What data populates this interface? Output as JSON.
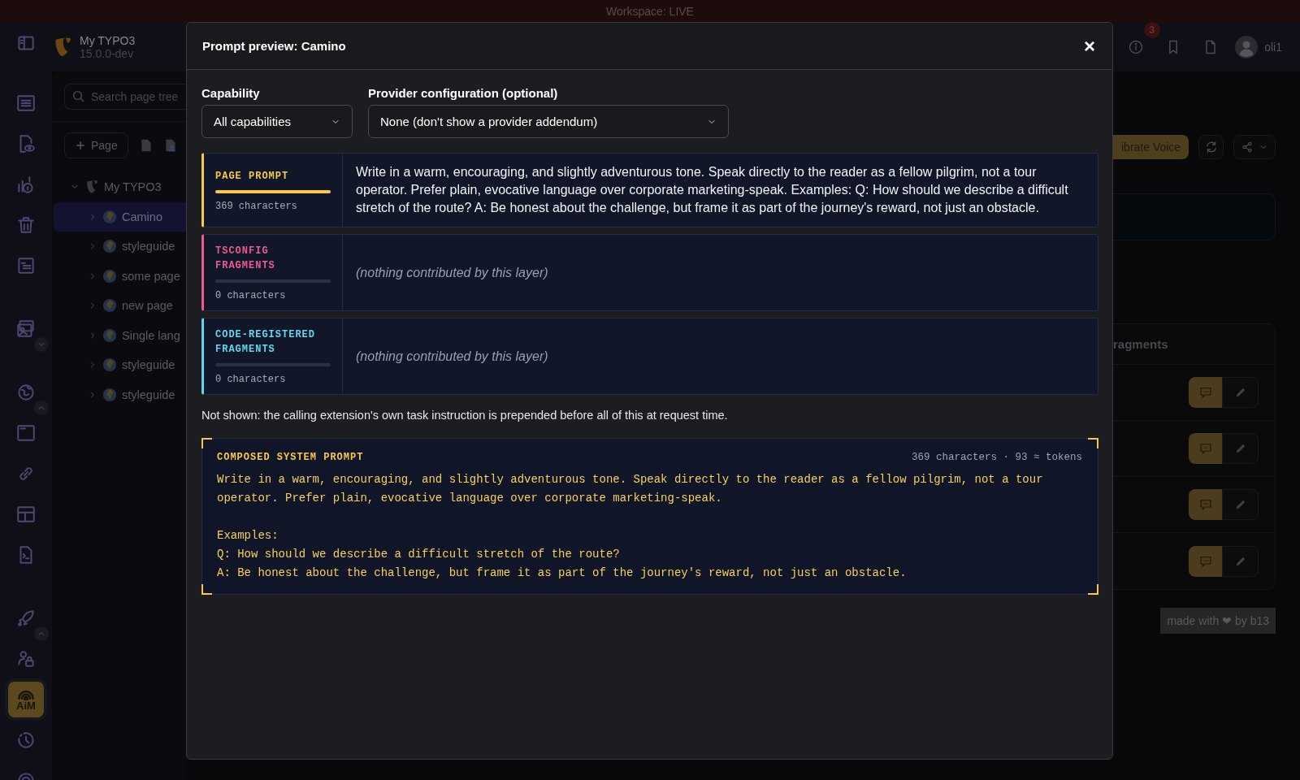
{
  "workspace_bar": {
    "label": "Workspace: LIVE"
  },
  "module_menu": {
    "groups": [
      [
        {
          "selected": false
        }
      ],
      [
        {
          "selected": false
        },
        {
          "selected": false
        },
        {
          "selected": false
        },
        {
          "selected": false
        },
        {
          "selected": false
        }
      ],
      [
        {
          "selected": false,
          "expanded": false
        }
      ],
      [
        {
          "selected": false,
          "expanded": true
        },
        {
          "selected": false
        },
        {
          "selected": false
        },
        {
          "selected": false
        },
        {
          "selected": false
        }
      ],
      [
        {
          "selected": false,
          "expanded": true
        },
        {
          "selected": false
        },
        {
          "selected": true,
          "label": "AiM"
        },
        {
          "selected": false
        },
        {
          "selected": false
        }
      ]
    ]
  },
  "site": {
    "name": "My TYPO3",
    "version": "15.0.0-dev"
  },
  "top_toolbar": {
    "badge": "3",
    "user": "oli1"
  },
  "page_tree": {
    "search": {
      "placeholder": "Search page tree"
    },
    "new_page_button": "Page",
    "root": {
      "title": "My TYPO3",
      "expanded": true,
      "children": [
        {
          "title": "Camino",
          "selected": true,
          "expanded": false
        },
        {
          "title": "styleguide",
          "selected": false,
          "expanded": false
        },
        {
          "title": "some page",
          "selected": false,
          "expanded": false
        },
        {
          "title": "new page",
          "selected": false,
          "expanded": false
        },
        {
          "title": "Single lang",
          "selected": false,
          "expanded": false
        },
        {
          "title": "styleguide",
          "selected": false,
          "expanded": false
        },
        {
          "title": "styleguide",
          "selected": false,
          "expanded": false
        }
      ]
    }
  },
  "module_content": {
    "calibrate_button": "ibrate Voice",
    "fragments_card": {
      "title": "ragments",
      "rows": [
        {
          "kind": "fragment"
        },
        {
          "kind": "fragment"
        },
        {
          "kind": "fragment"
        },
        {
          "kind": "fragment"
        }
      ]
    },
    "footer_badge": "made with ❤ by b13"
  },
  "dialog": {
    "title": "Prompt preview: Camino",
    "close_label": "×",
    "capability": {
      "label": "Capability",
      "value": "All capabilities"
    },
    "provider": {
      "label": "Provider configuration (optional)",
      "value": "None (don't show a provider addendum)"
    },
    "layers": [
      {
        "title": "PAGE PROMPT",
        "color": "#f7c948",
        "level": 1,
        "count": "369 characters",
        "kind": "text",
        "text": "Write in a warm, encouraging, and slightly adventurous tone. Speak directly to the reader as a fellow pilgrim, not a tour operator. Prefer plain, evocative language over corporate marketing-speak. Examples: Q: How should we describe a difficult stretch of the route? A: Be honest about the challenge, but frame it as part of the journey's reward, not just an obstacle."
      },
      {
        "title": "TSCONFIG FRAGMENTS",
        "color": "#ec5a93",
        "level": 0,
        "count": "0 characters",
        "kind": "empty",
        "text": "(nothing contributed by this layer)"
      },
      {
        "title": "CODE-REGISTERED FRAGMENTS",
        "color": "#62d6ee",
        "level": 0,
        "count": "0 characters",
        "kind": "empty",
        "text": "(nothing contributed by this layer)"
      }
    ],
    "note": "Not shown: the calling extension's own task instruction is prepended before all of this at request time.",
    "composed": {
      "title": "COMPOSED SYSTEM PROMPT",
      "meta": "369 characters · 93 ≈ tokens",
      "text": "Write in a warm, encouraging, and slightly adventurous tone. Speak directly to the reader as a fellow pilgrim, not a tour operator. Prefer plain, evocative language over corporate marketing-speak.\n\nExamples:\nQ: How should we describe a difficult stretch of the route?\nA: Be honest about the challenge, but frame it as part of the journey's reward, not just an obstacle."
    }
  }
}
